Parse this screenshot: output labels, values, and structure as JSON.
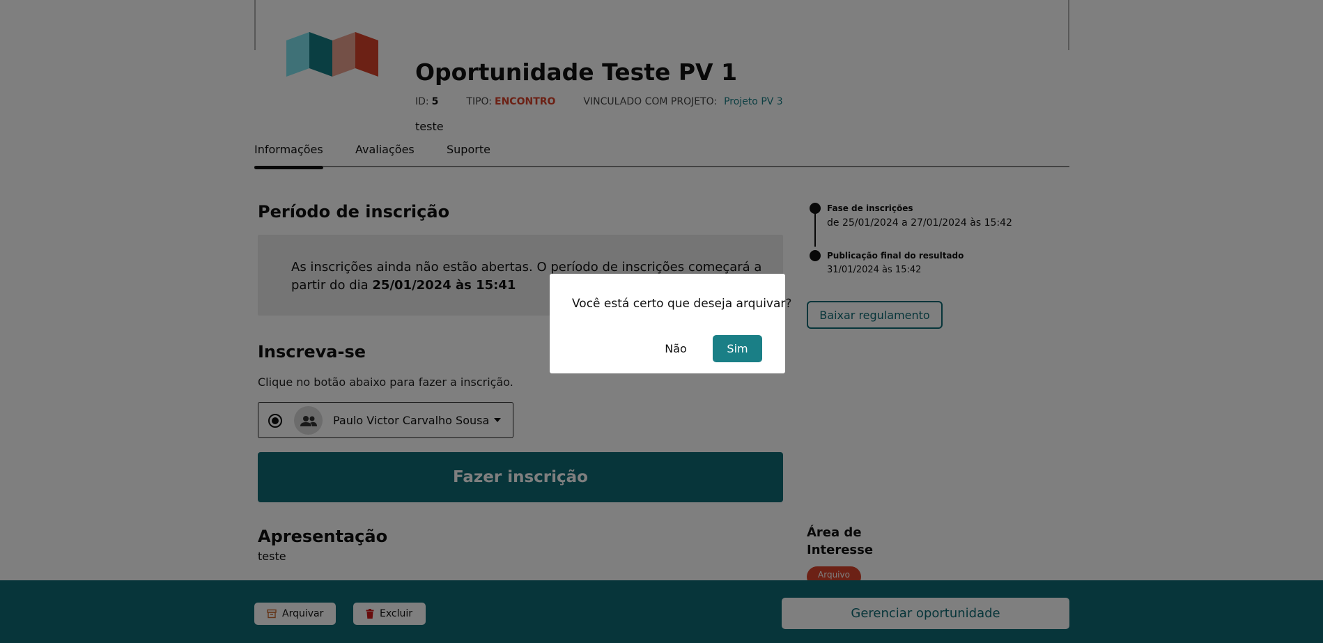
{
  "opportunity": {
    "title": "Oportunidade Teste PV 1",
    "id_label": "ID:",
    "id_value": "5",
    "type_label": "TIPO:",
    "type_value": "ENCONTRO",
    "project_label": "VINCULADO COM PROJETO:",
    "project_value": "Projeto PV 3",
    "subtitle": "teste"
  },
  "tabs": [
    {
      "label": "Informações",
      "active": true
    },
    {
      "label": "Avaliações",
      "active": false
    },
    {
      "label": "Suporte",
      "active": false
    }
  ],
  "registration_period": {
    "heading": "Período de inscrição",
    "notice_text": "As inscrições ainda não estão abertas. O período de inscrições começará a partir do dia ",
    "notice_date": "25/01/2024 às 15:41"
  },
  "subscribe": {
    "heading": "Inscreva-se",
    "helper": "Clique no botão abaixo para fazer a inscrição.",
    "agent_name": "Paulo Victor Carvalho Sousa",
    "button": "Fazer inscrição"
  },
  "presentation": {
    "heading": "Apresentação",
    "text": "teste"
  },
  "timeline": [
    {
      "title": "Fase de inscrições",
      "date": "de 25/01/2024 a 27/01/2024 às 15:42"
    },
    {
      "title": "Publicação final do resultado",
      "date": "31/01/2024 às 15:42"
    }
  ],
  "download_button": "Baixar regulamento",
  "interest_area": {
    "heading": "Área de Interesse",
    "tag": "Arquivo"
  },
  "bottom_bar": {
    "archive": "Arquivar",
    "delete": "Excluir",
    "manage": "Gerenciar oportunidade"
  },
  "modal": {
    "message": "Você está certo que deseja arquivar?",
    "no": "Não",
    "yes": "Sim"
  },
  "colors": {
    "accent": "#0e6b74",
    "tipo": "#d9432b",
    "tag": "#d9432b"
  }
}
